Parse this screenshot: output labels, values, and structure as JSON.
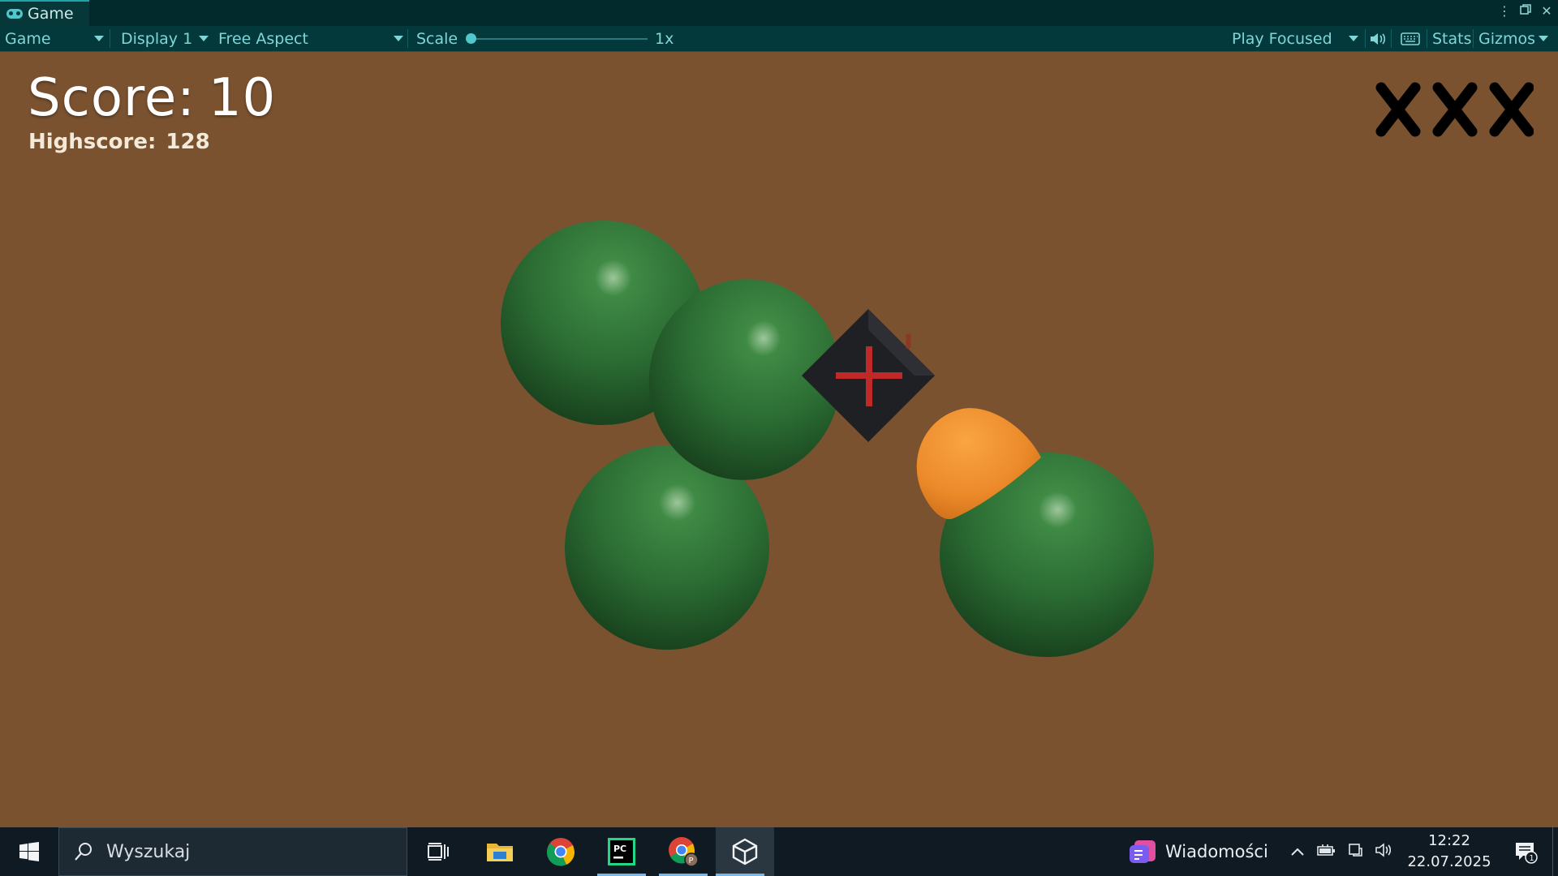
{
  "tab": {
    "label": "Game",
    "icon": "gamepad-icon"
  },
  "window_controls": [
    "kebab-menu-icon",
    "maximize-icon",
    "close-icon"
  ],
  "toolbar": {
    "view_mode": "Game",
    "display": "Display 1",
    "aspect": "Free Aspect",
    "scale_label": "Scale",
    "scale_value": "1x",
    "scale_fraction": 0.0,
    "play_mode": "Play Focused",
    "stats": "Stats",
    "gizmos": "Gizmos",
    "accent_color": "#7fd6d9"
  },
  "hud": {
    "score_label": "Score:",
    "score_value": "10",
    "highscore_label": "Highscore:",
    "highscore_value": "128",
    "lives_marks": [
      "X",
      "X",
      "X"
    ]
  },
  "scene": {
    "background_color": "#7a5230",
    "green_spheres": 4,
    "orange_hemisphere": 1,
    "crate_cross_color": "#c0282a"
  },
  "taskbar": {
    "search_placeholder": "Wyszukaj",
    "apps": [
      "task-view-icon",
      "file-explorer-icon",
      "chrome-icon",
      "pycharm-icon",
      "chrome-profile-icon",
      "unity-icon"
    ],
    "news_label": "Wiadomości",
    "time": "12:22",
    "date": "22.07.2025",
    "notification_count": "1"
  }
}
